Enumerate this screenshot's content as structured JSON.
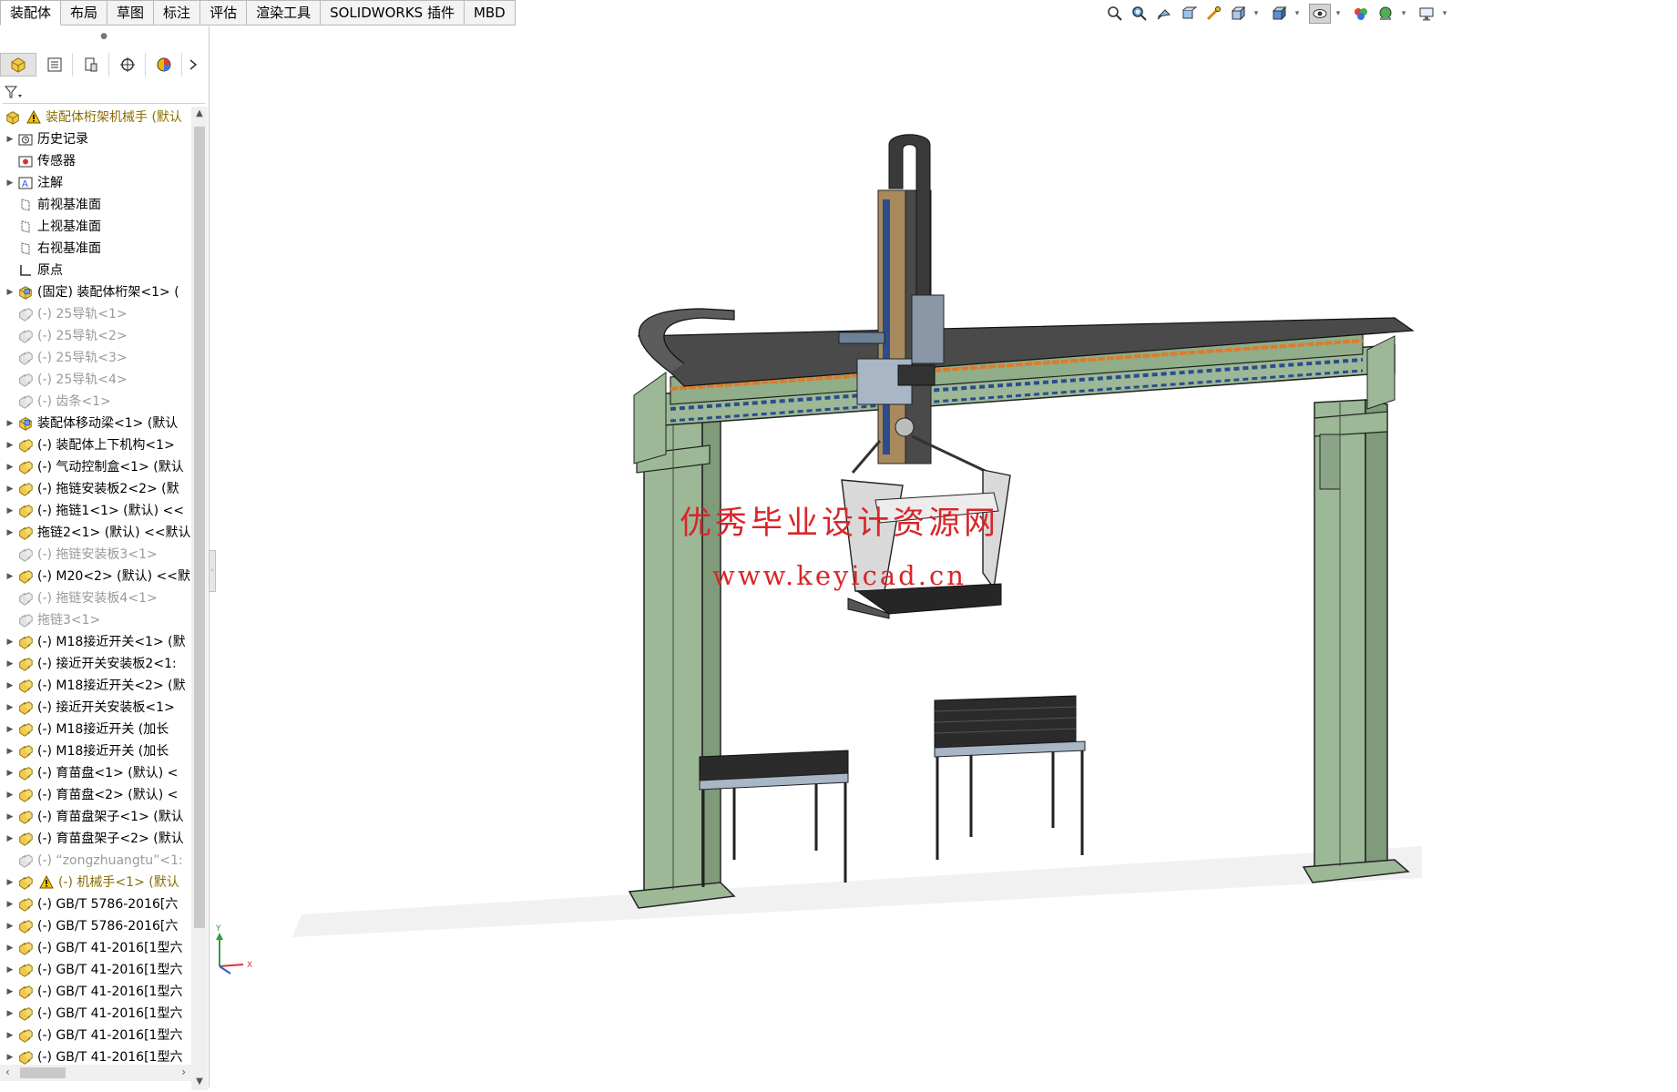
{
  "command_tabs": [
    {
      "label": "装配体",
      "active": true
    },
    {
      "label": "布局"
    },
    {
      "label": "草图"
    },
    {
      "label": "标注"
    },
    {
      "label": "评估"
    },
    {
      "label": "渲染工具"
    },
    {
      "label": "SOLIDWORKS 插件"
    },
    {
      "label": "MBD"
    }
  ],
  "view_toolbar": [
    "zoom-to-fit-icon",
    "zoom-to-area-icon",
    "previous-view-icon",
    "section-view-icon",
    "dynamic-annotation-icon",
    "view-orientation-icon",
    "display-style-icon",
    "hide-show-items-icon",
    "edit-appearance-icon",
    "apply-scene-icon",
    "view-settings-icon"
  ],
  "feature_tree": {
    "panel_tabs": [
      "featuremanager-icon",
      "propertymanager-icon",
      "configurationmanager-icon",
      "dimxpertmanager-icon",
      "displaymanager-icon"
    ],
    "root": "装配体桁架机械手 (默认",
    "items": [
      {
        "label": "历史记录",
        "icon": "history-folder",
        "expand": true
      },
      {
        "label": "传感器",
        "icon": "sensor",
        "expand": false
      },
      {
        "label": "注解",
        "icon": "annotation",
        "expand": true
      },
      {
        "label": "前视基准面",
        "icon": "plane",
        "expand": false
      },
      {
        "label": "上视基准面",
        "icon": "plane",
        "expand": false
      },
      {
        "label": "右视基准面",
        "icon": "plane",
        "expand": false
      },
      {
        "label": "原点",
        "icon": "origin",
        "expand": false
      },
      {
        "label": "(固定) 装配体桁架<1> (",
        "icon": "subassembly",
        "expand": true
      },
      {
        "label": "(-) 25导轨<1>",
        "icon": "part",
        "suppressed": true
      },
      {
        "label": "(-) 25导轨<2>",
        "icon": "part",
        "suppressed": true
      },
      {
        "label": "(-) 25导轨<3>",
        "icon": "part",
        "suppressed": true
      },
      {
        "label": "(-) 25导轨<4>",
        "icon": "part",
        "suppressed": true
      },
      {
        "label": "(-) 齿条<1>",
        "icon": "part",
        "suppressed": true
      },
      {
        "label": "装配体移动梁<1> (默认",
        "icon": "subassembly",
        "expand": true
      },
      {
        "label": "(-) 装配体上下机构<1>",
        "icon": "part",
        "expand": true
      },
      {
        "label": "(-) 气动控制盒<1> (默认",
        "icon": "part",
        "expand": true
      },
      {
        "label": "(-) 拖链安装板2<2> (默",
        "icon": "part",
        "expand": true
      },
      {
        "label": "(-) 拖链1<1> (默认) <<",
        "icon": "part",
        "expand": true
      },
      {
        "label": "拖链2<1> (默认) <<默认",
        "icon": "part",
        "expand": true
      },
      {
        "label": "(-) 拖链安装板3<1>",
        "icon": "part",
        "suppressed": true
      },
      {
        "label": "(-) M20<2> (默认) <<默",
        "icon": "part",
        "expand": true
      },
      {
        "label": "(-) 拖链安装板4<1>",
        "icon": "part",
        "suppressed": true
      },
      {
        "label": "拖链3<1>",
        "icon": "part",
        "suppressed": true
      },
      {
        "label": "(-) M18接近开关<1> (默",
        "icon": "part",
        "expand": true
      },
      {
        "label": "(-) 接近开关安装板2<1:",
        "icon": "part",
        "expand": true
      },
      {
        "label": "(-) M18接近开关<2> (默",
        "icon": "part",
        "expand": true
      },
      {
        "label": "(-) 接近开关安装板<1>",
        "icon": "part",
        "expand": true
      },
      {
        "label": "(-) M18接近开关 (加长",
        "icon": "part",
        "expand": true
      },
      {
        "label": "(-) M18接近开关 (加长",
        "icon": "part",
        "expand": true
      },
      {
        "label": "(-) 育苗盘<1> (默认) <",
        "icon": "part",
        "expand": true
      },
      {
        "label": "(-) 育苗盘<2> (默认) <",
        "icon": "part",
        "expand": true
      },
      {
        "label": "(-) 育苗盘架子<1> (默认",
        "icon": "part",
        "expand": true
      },
      {
        "label": "(-) 育苗盘架子<2> (默认",
        "icon": "part",
        "expand": true
      },
      {
        "label": "(-) “zongzhuangtu”<1:",
        "icon": "part",
        "suppressed": true
      },
      {
        "label": "(-) 机械手<1> (默认",
        "icon": "warning",
        "expand": true,
        "warn": true
      },
      {
        "label": "(-) GB/T 5786-2016[六",
        "icon": "part",
        "expand": true
      },
      {
        "label": "(-) GB/T 5786-2016[六",
        "icon": "part",
        "expand": true
      },
      {
        "label": "(-) GB/T 41-2016[1型六",
        "icon": "part",
        "expand": true
      },
      {
        "label": "(-) GB/T 41-2016[1型六",
        "icon": "part",
        "expand": true
      },
      {
        "label": "(-) GB/T 41-2016[1型六",
        "icon": "part",
        "expand": true
      },
      {
        "label": "(-) GB/T 41-2016[1型六",
        "icon": "part",
        "expand": true
      },
      {
        "label": "(-) GB/T 41-2016[1型六",
        "icon": "part",
        "expand": true
      },
      {
        "label": "(-) GB/T 41-2016[1型六",
        "icon": "part",
        "expand": true
      }
    ]
  },
  "viewport": {
    "watermark_cn": "优秀毕业设计资源网",
    "watermark_url": "www.keyicad.cn",
    "triad": {
      "y": "Y",
      "x": "X"
    }
  },
  "colors": {
    "frame_green": "#9cb896",
    "watermark_red": "#d8262a",
    "orange_rail": "#e07a2a"
  }
}
